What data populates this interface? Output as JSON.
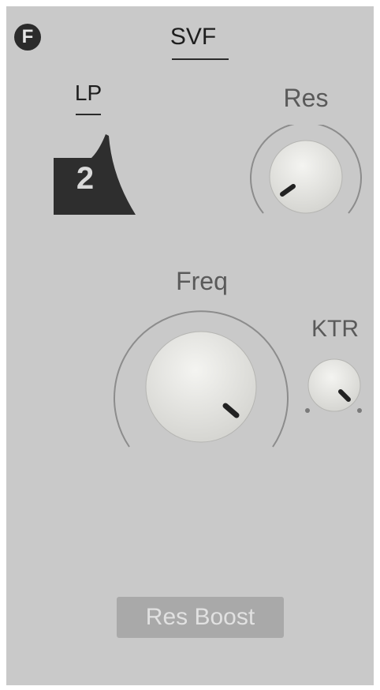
{
  "header": {
    "badge": "F",
    "title": "SVF"
  },
  "filter": {
    "mode": "LP",
    "slope": "2"
  },
  "knobs": {
    "res": {
      "label": "Res"
    },
    "freq": {
      "label": "Freq"
    },
    "ktr": {
      "label": "KTR"
    }
  },
  "footer": {
    "res_boost": "Res Boost"
  },
  "colors": {
    "panel": "#c9c9c9",
    "dark": "#2b2b2b",
    "label": "#5a5a5a",
    "knob": "#ececea",
    "button": "#a9a9a9"
  }
}
